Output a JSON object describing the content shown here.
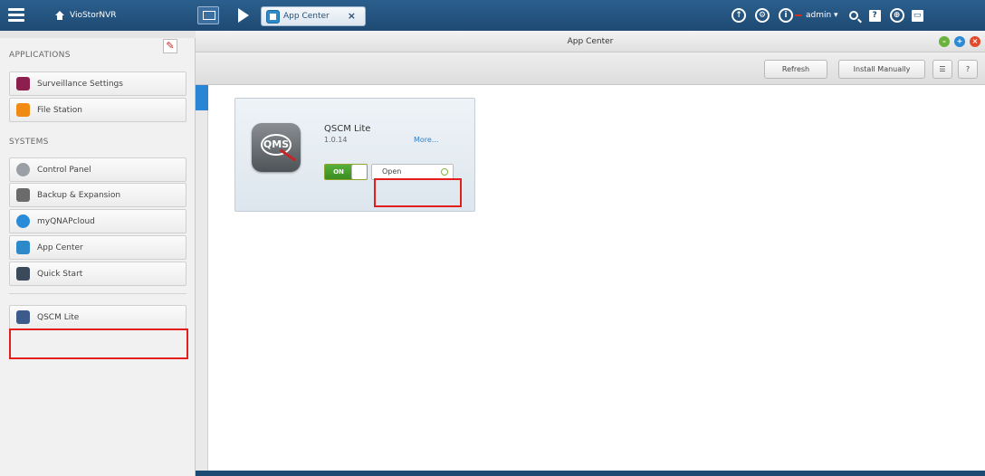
{
  "topbar": {
    "home_label": "VioStorNVR",
    "tab_label": "App Center",
    "tab_close": "×",
    "notification_count": "",
    "admin_label": "admin ▾",
    "icons": [
      "menu-icon",
      "home-icon",
      "monitor-icon",
      "play-icon",
      "upload-icon",
      "settings-icon",
      "info-icon",
      "search-icon",
      "help-icon",
      "globe-icon",
      "display-icon"
    ]
  },
  "sidebar": {
    "applications_header": "APPLICATIONS",
    "applications": [
      {
        "label": "Surveillance Settings"
      },
      {
        "label": "File Station"
      }
    ],
    "systems_header": "SYSTEMS",
    "systems": [
      {
        "label": "Control Panel"
      },
      {
        "label": "Backup & Expansion"
      },
      {
        "label": "myQNAPcloud"
      },
      {
        "label": "App Center"
      },
      {
        "label": "Quick Start"
      }
    ],
    "installed": [
      {
        "label": "QSCM Lite"
      }
    ]
  },
  "window": {
    "title": "App Center",
    "min_glyph": "–",
    "max_glyph": "+",
    "close_glyph": "×"
  },
  "toolbar": {
    "refresh_label": "Refresh",
    "install_manually_label": "Install Manually",
    "view_glyph": "☰",
    "help_glyph": "?"
  },
  "app": {
    "name": "QSCM Lite",
    "version": "1.0.14",
    "more_label": "More...",
    "logo_text": "QMS",
    "toggle_label": "ON",
    "open_label": "Open"
  },
  "colors": {
    "topbar": "#1d4a73",
    "accent_blue": "#2a86d4",
    "highlight_red": "#e41d1d",
    "toggle_green": "#3a8c22"
  }
}
